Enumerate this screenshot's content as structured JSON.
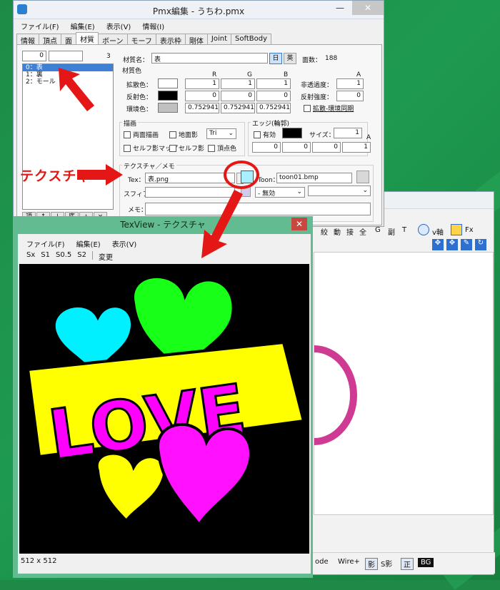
{
  "main_window": {
    "title": "Pmx編集 - うちわ.pmx",
    "minimize": "—",
    "close": "✕",
    "menu": [
      "ファイル(F)",
      "編集(E)",
      "表示(V)",
      "情報(I)"
    ],
    "tabs": [
      "情報",
      "頂点",
      "面",
      "材質",
      "ボーン",
      "モーフ",
      "表示枠",
      "剛体",
      "Joint",
      "SoftBody"
    ],
    "active_tab": "材質"
  },
  "material_list": {
    "index_value": "0",
    "count": "3",
    "items": [
      "0：表",
      "1：裏",
      "2：モール"
    ],
    "selected": "0：表",
    "buttons": [
      "頂",
      "↑",
      "↓",
      "底",
      "+",
      "×"
    ]
  },
  "material": {
    "name_label": "材質名：",
    "name_value": "表",
    "lang_jp": "日",
    "lang_en": "英",
    "face_count_label": "面数：",
    "face_count": "188",
    "color_section": "材質色",
    "rgba_headers": [
      "R",
      "G",
      "B",
      "A"
    ],
    "diffuse_label": "拡散色：",
    "diffuse": [
      "1",
      "1",
      "1"
    ],
    "diffuse_color": "#ffffff",
    "specular_label": "反射色：",
    "specular": [
      "0",
      "0",
      "0"
    ],
    "specular_color": "#000000",
    "ambient_label": "環境色：",
    "ambient": [
      "0.7529412",
      "0.7529412",
      "0.7529412"
    ],
    "ambient_color": "#c0c0c0",
    "alpha_label": "非透過度：",
    "alpha": "1",
    "shininess_label": "反射強度：",
    "shininess": "0",
    "sync_label": "拡散-環境同期"
  },
  "drawing": {
    "title": "描画",
    "double_side": "両面描画",
    "ground_shadow": "地面影",
    "prim_type": "Tri",
    "self_shadow_map": "セルフ影マップ",
    "self_shadow": "セルフ影",
    "vertex_color": "頂点色"
  },
  "edge": {
    "title": "エッジ(輪郭)",
    "enabled": "有効",
    "color": "#000000",
    "size_label": "サイズ：",
    "size": "1",
    "a_label": "A",
    "rgba": [
      "0",
      "0",
      "0",
      "1"
    ]
  },
  "texture": {
    "title": "テクスチャ／メモ",
    "tex_label": "Tex：",
    "tex_value": "表.png",
    "toon_label": "Toon：",
    "toon_value": "toon01.bmp",
    "sphere_label": "スフィア：",
    "sphere_mode": "- 無効",
    "memo_label": "メモ：",
    "tex_button_color": "#a8f0ff"
  },
  "texview": {
    "title": "TexView - テクスチャ",
    "close": "✕",
    "menu": [
      "ファイル(F)",
      "編集(E)",
      "表示(V)"
    ],
    "tools": [
      "Sx",
      "S1",
      "S0.5",
      "S2",
      "変更"
    ],
    "size": "512 x 512",
    "love_text": "LOVE"
  },
  "viewer": {
    "toolbar_glyphs": [
      "絞",
      "動",
      "接",
      "全",
      "G",
      "副",
      "T"
    ],
    "toolbar_extra": [
      "Fx"
    ],
    "bottom": [
      "ode",
      "Wire+",
      "影",
      "S影",
      "正",
      "BG"
    ]
  },
  "annotation": {
    "label": "テクスチャ",
    "color": "#e41616"
  }
}
